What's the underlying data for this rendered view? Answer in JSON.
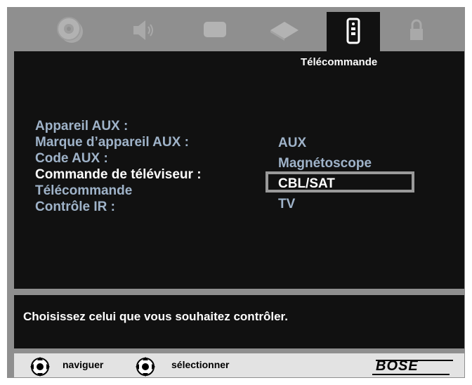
{
  "tabs": [
    {
      "icon": "disc-icon",
      "active": false
    },
    {
      "icon": "speaker-icon",
      "active": false
    },
    {
      "icon": "display-icon",
      "active": false
    },
    {
      "icon": "device-icon",
      "active": false
    },
    {
      "icon": "remote-icon",
      "active": true,
      "label": "Télécommande"
    },
    {
      "icon": "lock-icon",
      "active": false
    }
  ],
  "menu": {
    "items": [
      {
        "label": "Appareil AUX :"
      },
      {
        "label": "Marque d’appareil AUX :"
      },
      {
        "label": "Code AUX :"
      },
      {
        "label": "Commande de téléviseur :",
        "selected": true
      },
      {
        "label": "Télécommande"
      },
      {
        "label": "Contrôle IR :"
      }
    ]
  },
  "options": [
    {
      "label": "AUX"
    },
    {
      "label": "Magnétoscope"
    },
    {
      "label": "CBL/SAT",
      "selected": true
    },
    {
      "label": "TV"
    }
  ],
  "message": "Choisissez celui que vous souhaitez contrôler.",
  "footer": {
    "navigate_label": "naviguer",
    "select_label": "sélectionner",
    "brand": "BOSE"
  },
  "colors": {
    "panel": "#111111",
    "frame": "#8f8f8f",
    "menu_text": "#9fb3c9",
    "selected_text": "#ffffff",
    "selection_border": "#9a9a9a"
  }
}
